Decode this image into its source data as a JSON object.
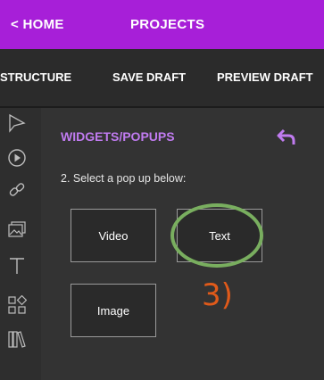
{
  "nav": {
    "home": "< HOME",
    "projects": "PROJECTS"
  },
  "toolbar": {
    "structure": "STRUCTURE",
    "save_draft": "SAVE DRAFT",
    "preview_draft": "PREVIEW DRAFT"
  },
  "rail": [
    "cursor-icon",
    "play-icon",
    "link-icon",
    "image-gallery-icon",
    "text-icon",
    "widgets-icon",
    "library-icon"
  ],
  "panel": {
    "title": "WIDGETS/POPUPS",
    "instruction": "2. Select a pop up below:",
    "widgets": {
      "video": "Video",
      "text": "Text",
      "image": "Image"
    }
  },
  "annotation": {
    "step": "3)"
  },
  "colors": {
    "brand": "#a71fd8",
    "title": "#c07bf0",
    "ring": "#79ae5f",
    "step": "#e05a1a"
  }
}
